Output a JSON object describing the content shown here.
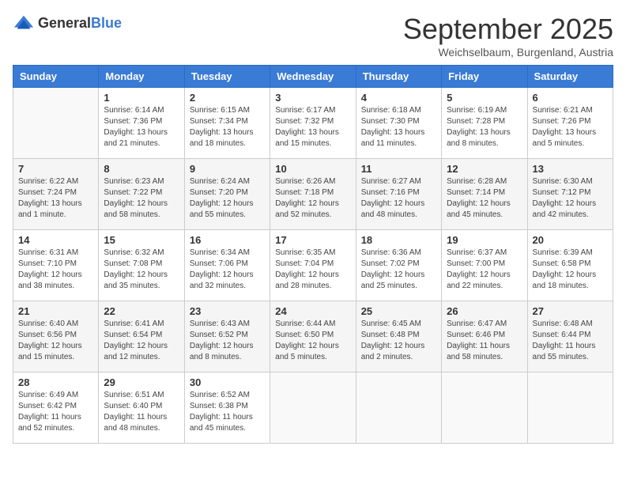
{
  "logo": {
    "general": "General",
    "blue": "Blue"
  },
  "header": {
    "month": "September 2025",
    "location": "Weichselbaum, Burgenland, Austria"
  },
  "days_of_week": [
    "Sunday",
    "Monday",
    "Tuesday",
    "Wednesday",
    "Thursday",
    "Friday",
    "Saturday"
  ],
  "weeks": [
    [
      {
        "day": "",
        "info": ""
      },
      {
        "day": "1",
        "info": "Sunrise: 6:14 AM\nSunset: 7:36 PM\nDaylight: 13 hours\nand 21 minutes."
      },
      {
        "day": "2",
        "info": "Sunrise: 6:15 AM\nSunset: 7:34 PM\nDaylight: 13 hours\nand 18 minutes."
      },
      {
        "day": "3",
        "info": "Sunrise: 6:17 AM\nSunset: 7:32 PM\nDaylight: 13 hours\nand 15 minutes."
      },
      {
        "day": "4",
        "info": "Sunrise: 6:18 AM\nSunset: 7:30 PM\nDaylight: 13 hours\nand 11 minutes."
      },
      {
        "day": "5",
        "info": "Sunrise: 6:19 AM\nSunset: 7:28 PM\nDaylight: 13 hours\nand 8 minutes."
      },
      {
        "day": "6",
        "info": "Sunrise: 6:21 AM\nSunset: 7:26 PM\nDaylight: 13 hours\nand 5 minutes."
      }
    ],
    [
      {
        "day": "7",
        "info": "Sunrise: 6:22 AM\nSunset: 7:24 PM\nDaylight: 13 hours\nand 1 minute."
      },
      {
        "day": "8",
        "info": "Sunrise: 6:23 AM\nSunset: 7:22 PM\nDaylight: 12 hours\nand 58 minutes."
      },
      {
        "day": "9",
        "info": "Sunrise: 6:24 AM\nSunset: 7:20 PM\nDaylight: 12 hours\nand 55 minutes."
      },
      {
        "day": "10",
        "info": "Sunrise: 6:26 AM\nSunset: 7:18 PM\nDaylight: 12 hours\nand 52 minutes."
      },
      {
        "day": "11",
        "info": "Sunrise: 6:27 AM\nSunset: 7:16 PM\nDaylight: 12 hours\nand 48 minutes."
      },
      {
        "day": "12",
        "info": "Sunrise: 6:28 AM\nSunset: 7:14 PM\nDaylight: 12 hours\nand 45 minutes."
      },
      {
        "day": "13",
        "info": "Sunrise: 6:30 AM\nSunset: 7:12 PM\nDaylight: 12 hours\nand 42 minutes."
      }
    ],
    [
      {
        "day": "14",
        "info": "Sunrise: 6:31 AM\nSunset: 7:10 PM\nDaylight: 12 hours\nand 38 minutes."
      },
      {
        "day": "15",
        "info": "Sunrise: 6:32 AM\nSunset: 7:08 PM\nDaylight: 12 hours\nand 35 minutes."
      },
      {
        "day": "16",
        "info": "Sunrise: 6:34 AM\nSunset: 7:06 PM\nDaylight: 12 hours\nand 32 minutes."
      },
      {
        "day": "17",
        "info": "Sunrise: 6:35 AM\nSunset: 7:04 PM\nDaylight: 12 hours\nand 28 minutes."
      },
      {
        "day": "18",
        "info": "Sunrise: 6:36 AM\nSunset: 7:02 PM\nDaylight: 12 hours\nand 25 minutes."
      },
      {
        "day": "19",
        "info": "Sunrise: 6:37 AM\nSunset: 7:00 PM\nDaylight: 12 hours\nand 22 minutes."
      },
      {
        "day": "20",
        "info": "Sunrise: 6:39 AM\nSunset: 6:58 PM\nDaylight: 12 hours\nand 18 minutes."
      }
    ],
    [
      {
        "day": "21",
        "info": "Sunrise: 6:40 AM\nSunset: 6:56 PM\nDaylight: 12 hours\nand 15 minutes."
      },
      {
        "day": "22",
        "info": "Sunrise: 6:41 AM\nSunset: 6:54 PM\nDaylight: 12 hours\nand 12 minutes."
      },
      {
        "day": "23",
        "info": "Sunrise: 6:43 AM\nSunset: 6:52 PM\nDaylight: 12 hours\nand 8 minutes."
      },
      {
        "day": "24",
        "info": "Sunrise: 6:44 AM\nSunset: 6:50 PM\nDaylight: 12 hours\nand 5 minutes."
      },
      {
        "day": "25",
        "info": "Sunrise: 6:45 AM\nSunset: 6:48 PM\nDaylight: 12 hours\nand 2 minutes."
      },
      {
        "day": "26",
        "info": "Sunrise: 6:47 AM\nSunset: 6:46 PM\nDaylight: 11 hours\nand 58 minutes."
      },
      {
        "day": "27",
        "info": "Sunrise: 6:48 AM\nSunset: 6:44 PM\nDaylight: 11 hours\nand 55 minutes."
      }
    ],
    [
      {
        "day": "28",
        "info": "Sunrise: 6:49 AM\nSunset: 6:42 PM\nDaylight: 11 hours\nand 52 minutes."
      },
      {
        "day": "29",
        "info": "Sunrise: 6:51 AM\nSunset: 6:40 PM\nDaylight: 11 hours\nand 48 minutes."
      },
      {
        "day": "30",
        "info": "Sunrise: 6:52 AM\nSunset: 6:38 PM\nDaylight: 11 hours\nand 45 minutes."
      },
      {
        "day": "",
        "info": ""
      },
      {
        "day": "",
        "info": ""
      },
      {
        "day": "",
        "info": ""
      },
      {
        "day": "",
        "info": ""
      }
    ]
  ]
}
